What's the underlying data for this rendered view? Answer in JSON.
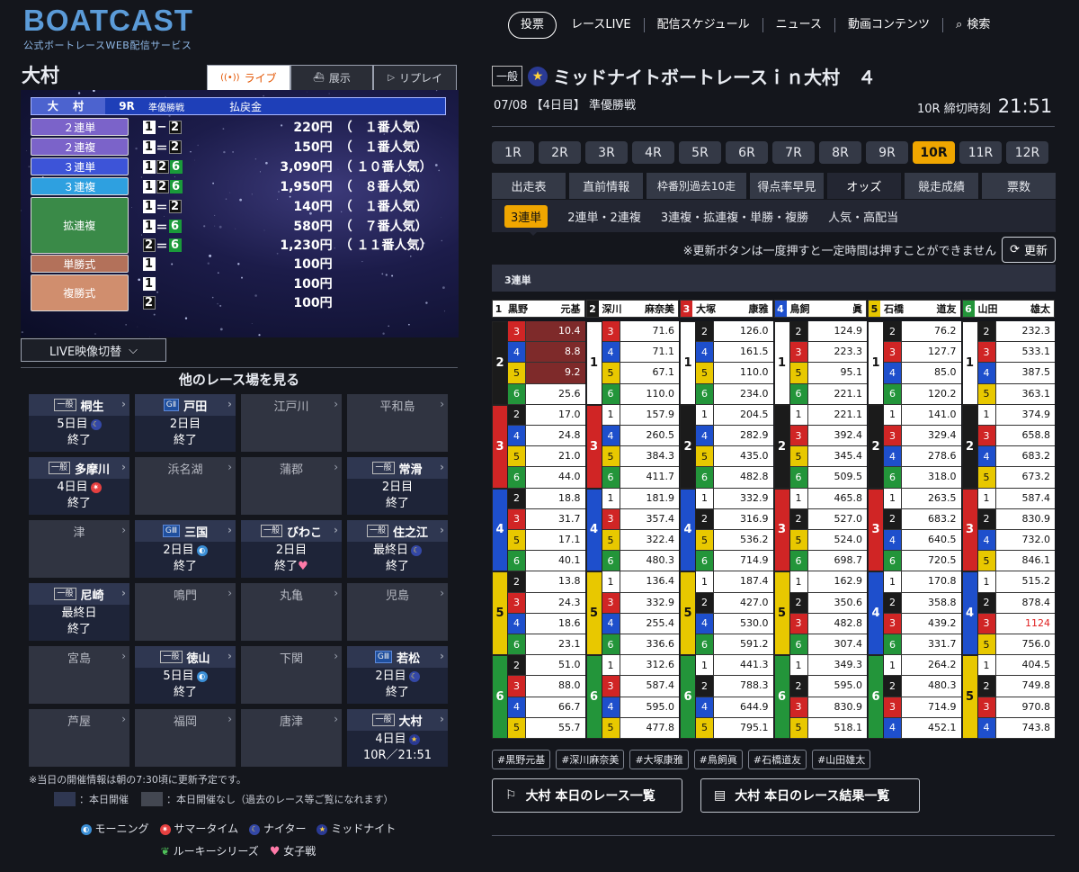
{
  "header": {
    "logo": "BOATCAST",
    "logo_sub": "公式ボートレースWEB配信サービス",
    "nav": [
      "投票",
      "レースLIVE",
      "配信スケジュール",
      "ニュース",
      "動画コンテンツ",
      "検索"
    ]
  },
  "left": {
    "venue": "大村",
    "tabs": [
      "ライブ",
      "展示",
      "リプレイ"
    ],
    "payout": {
      "venue": "大 村",
      "race": "9R",
      "race_name": "準優勝戦",
      "col": "払戻金",
      "rows": [
        {
          "label": "２連単",
          "nums": [
            "1",
            "2"
          ],
          "sep": "−",
          "amount": "220円",
          "pop": "（　１番人気）",
          "color": "#7b63c9"
        },
        {
          "label": "２連複",
          "nums": [
            "1",
            "2"
          ],
          "sep": "＝",
          "amount": "150円",
          "pop": "（　１番人気）",
          "color": "#7b63c9"
        },
        {
          "label": "３連単",
          "nums": [
            "1",
            "2",
            "6"
          ],
          "sep": "",
          "amount": "3,090円",
          "pop": "（ １０番人気）",
          "color": "#3d54d8"
        },
        {
          "label": "３連複",
          "nums": [
            "1",
            "2",
            "6"
          ],
          "sep": "",
          "amount": "1,950円",
          "pop": "（　８番人気）",
          "color": "#2ea0e0"
        },
        {
          "label": "拡連複",
          "nums": [
            "1",
            "2"
          ],
          "sep": "＝",
          "amount": "140円",
          "pop": "（　１番人気）",
          "color": "#3a8a48"
        },
        {
          "label": "",
          "nums": [
            "1",
            "6"
          ],
          "sep": "＝",
          "amount": "580円",
          "pop": "（　７番人気）",
          "color": ""
        },
        {
          "label": "",
          "nums": [
            "2",
            "6"
          ],
          "sep": "＝",
          "amount": "1,230円",
          "pop": "（ １１番人気）",
          "color": ""
        },
        {
          "label": "単勝式",
          "nums": [
            "1"
          ],
          "sep": "",
          "amount": "100円",
          "pop": "",
          "color": "#b3715a"
        },
        {
          "label": "複勝式",
          "nums": [
            "1"
          ],
          "sep": "",
          "amount": "100円",
          "pop": "",
          "color": "#d08e6e"
        },
        {
          "label": "",
          "nums": [
            "2"
          ],
          "sep": "",
          "amount": "100円",
          "pop": "",
          "color": ""
        }
      ]
    },
    "live_switch": "LIVE映像切替",
    "other_title": "他のレース場を見る",
    "venues": [
      {
        "name": "桐生",
        "grade": "一般",
        "day": "5日目",
        "icon": "moon",
        "status": "終了",
        "active": true
      },
      {
        "name": "戸田",
        "grade": "GⅡ",
        "day": "2日目",
        "icon": "",
        "status": "終了",
        "active": true
      },
      {
        "name": "江戸川",
        "grade": "",
        "day": "",
        "icon": "",
        "status": "",
        "active": false
      },
      {
        "name": "平和島",
        "grade": "",
        "day": "",
        "icon": "",
        "status": "",
        "active": false
      },
      {
        "name": "多摩川",
        "grade": "一般",
        "day": "4日目",
        "icon": "sum",
        "status": "終了",
        "active": true
      },
      {
        "name": "浜名湖",
        "grade": "",
        "day": "",
        "icon": "",
        "status": "",
        "active": false
      },
      {
        "name": "蒲郡",
        "grade": "",
        "day": "",
        "icon": "",
        "status": "",
        "active": false
      },
      {
        "name": "常滑",
        "grade": "一般",
        "day": "2日目",
        "icon": "",
        "status": "終了",
        "active": true
      },
      {
        "name": "津",
        "grade": "",
        "day": "",
        "icon": "",
        "status": "",
        "active": false
      },
      {
        "name": "三国",
        "grade": "GⅢ",
        "day": "2日目",
        "icon": "morn",
        "status": "終了",
        "active": true
      },
      {
        "name": "びわこ",
        "grade": "一般",
        "day": "2日目",
        "icon": "",
        "status": "終了",
        "heart": true,
        "active": true
      },
      {
        "name": "住之江",
        "grade": "一般",
        "day": "最終日",
        "icon": "moon",
        "status": "終了",
        "active": true
      },
      {
        "name": "尼崎",
        "grade": "一般",
        "day": "最終日",
        "icon": "",
        "status": "終了",
        "active": true
      },
      {
        "name": "鳴門",
        "grade": "",
        "day": "",
        "icon": "",
        "status": "",
        "active": false
      },
      {
        "name": "丸亀",
        "grade": "",
        "day": "",
        "icon": "",
        "status": "",
        "active": false
      },
      {
        "name": "児島",
        "grade": "",
        "day": "",
        "icon": "",
        "status": "",
        "active": false
      },
      {
        "name": "宮島",
        "grade": "",
        "day": "",
        "icon": "",
        "status": "",
        "active": false
      },
      {
        "name": "徳山",
        "grade": "一般",
        "day": "5日目",
        "icon": "morn",
        "status": "終了",
        "active": true
      },
      {
        "name": "下関",
        "grade": "",
        "day": "",
        "icon": "",
        "status": "",
        "active": false
      },
      {
        "name": "若松",
        "grade": "GⅢ",
        "day": "2日目",
        "icon": "moon",
        "status": "終了",
        "active": true
      },
      {
        "name": "芦屋",
        "grade": "",
        "day": "",
        "icon": "",
        "status": "",
        "active": false
      },
      {
        "name": "福岡",
        "grade": "",
        "day": "",
        "icon": "",
        "status": "",
        "active": false
      },
      {
        "name": "唐津",
        "grade": "",
        "day": "",
        "icon": "",
        "status": "",
        "active": false
      },
      {
        "name": "大村",
        "grade": "一般",
        "day": "4日目",
        "icon": "star",
        "status": "10R／21:51",
        "active": true
      }
    ],
    "note": "※当日の開催情報は朝の7:30頃に更新予定です。",
    "legend_active": "：本日開催",
    "legend_inactive": "：本日開催なし（過去のレース等ご覧になれます）",
    "legend_icons": [
      "モーニング",
      "サマータイム",
      "ナイター",
      "ミッドナイト",
      "ルーキーシリーズ",
      "女子戦"
    ]
  },
  "right": {
    "grade": "一般",
    "title": "ミッドナイトボートレースｉｎ大村　４",
    "subtitle": "07/08 【4日目】 準優勝戦",
    "deadline_label": "10R 締切時刻",
    "deadline_time": "21:51",
    "races": [
      "1R",
      "2R",
      "3R",
      "4R",
      "5R",
      "6R",
      "7R",
      "8R",
      "9R",
      "10R",
      "11R",
      "12R"
    ],
    "active_race": "10R",
    "tabs": [
      "出走表",
      "直前情報",
      "枠番別過去10走",
      "得点率早見",
      "オッズ",
      "競走成績",
      "票数"
    ],
    "active_tab": "オッズ",
    "odds_tabs": [
      "3連単",
      "2連単・2連複",
      "3連複・拡連複・単勝・複勝",
      "人気・高配当"
    ],
    "update_note": "※更新ボタンは一度押すと一定時間は押すことができません",
    "update_btn": "更新",
    "table_title": "3連単",
    "racers": [
      {
        "no": "1",
        "sei": "黒野",
        "mei": "元基"
      },
      {
        "no": "2",
        "sei": "深川",
        "mei": "麻奈美"
      },
      {
        "no": "3",
        "sei": "大塚",
        "mei": "康雅"
      },
      {
        "no": "4",
        "sei": "鳥飼",
        "mei": "眞"
      },
      {
        "no": "5",
        "sei": "石橋",
        "mei": "道友"
      },
      {
        "no": "6",
        "sei": "山田",
        "mei": "雄太"
      }
    ],
    "odds": [
      [
        [
          "2",
          [
            [
              "1",
              [
                [
                  "3",
                  "10.4"
                ],
                [
                  "4",
                  "8.8"
                ],
                [
                  "5",
                  "9.2"
                ],
                [
                  "6",
                  "25.6"
                ]
              ]
            ]
          ]
        ],
        [
          "3",
          [
            [
              "2",
              "17.0"
            ],
            [
              "4",
              "24.8"
            ],
            [
              "5",
              "21.0"
            ],
            [
              "6",
              "44.0"
            ]
          ]
        ],
        [
          "4",
          [
            [
              "2",
              "18.8"
            ],
            [
              "3",
              "31.7"
            ],
            [
              "5",
              "17.1"
            ],
            [
              "6",
              "40.1"
            ]
          ]
        ],
        [
          "5",
          [
            [
              "2",
              "13.8"
            ],
            [
              "3",
              "24.3"
            ],
            [
              "4",
              "18.6"
            ],
            [
              "6",
              "23.1"
            ]
          ]
        ],
        [
          "6",
          [
            [
              "2",
              "51.0"
            ],
            [
              "3",
              "88.0"
            ],
            [
              "4",
              "66.7"
            ],
            [
              "5",
              "55.7"
            ]
          ]
        ]
      ]
    ],
    "hashtags": [
      "#黒野元基",
      "#深川麻奈美",
      "#大塚康雅",
      "#鳥飼眞",
      "#石橋道友",
      "#山田雄太"
    ],
    "link1": "大村 本日のレース一覧",
    "link2": "大村 本日のレース結果一覧",
    "grid": {
      "second": [
        [
          "2",
          "3",
          "4",
          "5",
          "6"
        ],
        [
          "1",
          "3",
          "4",
          "5",
          "6"
        ],
        [
          "1",
          "2",
          "4",
          "5",
          "6"
        ],
        [
          "1",
          "2",
          "3",
          "5",
          "6"
        ],
        [
          "1",
          "2",
          "3",
          "4",
          "6"
        ],
        [
          "1",
          "2",
          "3",
          "4",
          "5"
        ]
      ],
      "thirds": [
        [
          [
            "3",
            "4",
            "5",
            "6"
          ],
          [
            "2",
            "4",
            "5",
            "6"
          ],
          [
            "2",
            "3",
            "5",
            "6"
          ],
          [
            "2",
            "3",
            "4",
            "6"
          ],
          [
            "2",
            "3",
            "4",
            "5"
          ]
        ],
        [
          [
            "3",
            "4",
            "5",
            "6"
          ],
          [
            "1",
            "4",
            "5",
            "6"
          ],
          [
            "1",
            "3",
            "5",
            "6"
          ],
          [
            "1",
            "3",
            "4",
            "6"
          ],
          [
            "1",
            "3",
            "4",
            "5"
          ]
        ],
        [
          [
            "2",
            "4",
            "5",
            "6"
          ],
          [
            "1",
            "4",
            "5",
            "6"
          ],
          [
            "1",
            "2",
            "5",
            "6"
          ],
          [
            "1",
            "2",
            "4",
            "6"
          ],
          [
            "1",
            "2",
            "4",
            "5"
          ]
        ],
        [
          [
            "2",
            "3",
            "5",
            "6"
          ],
          [
            "1",
            "3",
            "5",
            "6"
          ],
          [
            "1",
            "2",
            "5",
            "6"
          ],
          [
            "1",
            "2",
            "3",
            "6"
          ],
          [
            "1",
            "2",
            "3",
            "5"
          ]
        ],
        [
          [
            "2",
            "3",
            "4",
            "6"
          ],
          [
            "1",
            "3",
            "4",
            "6"
          ],
          [
            "1",
            "2",
            "4",
            "6"
          ],
          [
            "1",
            "2",
            "3",
            "6"
          ],
          [
            "1",
            "2",
            "3",
            "4"
          ]
        ],
        [
          [
            "2",
            "3",
            "4",
            "5"
          ],
          [
            "1",
            "3",
            "4",
            "5"
          ],
          [
            "1",
            "2",
            "4",
            "5"
          ],
          [
            "1",
            "2",
            "3",
            "5"
          ],
          [
            "1",
            "2",
            "3",
            "4"
          ]
        ]
      ],
      "values": [
        [
          [
            "10.4",
            "8.8",
            "9.2",
            "25.6"
          ],
          [
            "17.0",
            "24.8",
            "21.0",
            "44.0"
          ],
          [
            "18.8",
            "31.7",
            "17.1",
            "40.1"
          ],
          [
            "13.8",
            "24.3",
            "18.6",
            "23.1"
          ],
          [
            "51.0",
            "88.0",
            "66.7",
            "55.7"
          ]
        ],
        [
          [
            "71.6",
            "71.1",
            "67.1",
            "110.0"
          ],
          [
            "157.9",
            "260.5",
            "384.3",
            "411.7"
          ],
          [
            "181.9",
            "357.4",
            "322.4",
            "480.3"
          ],
          [
            "136.4",
            "332.9",
            "255.4",
            "336.6"
          ],
          [
            "312.6",
            "587.4",
            "595.0",
            "477.8"
          ]
        ],
        [
          [
            "126.0",
            "161.5",
            "110.0",
            "234.0"
          ],
          [
            "204.5",
            "282.9",
            "435.0",
            "482.8"
          ],
          [
            "332.9",
            "316.9",
            "536.2",
            "714.9"
          ],
          [
            "187.4",
            "427.0",
            "530.0",
            "591.2"
          ],
          [
            "441.3",
            "788.3",
            "644.9",
            "795.1"
          ]
        ],
        [
          [
            "124.9",
            "223.3",
            "95.1",
            "221.1"
          ],
          [
            "221.1",
            "392.4",
            "345.4",
            "509.5"
          ],
          [
            "465.8",
            "527.0",
            "524.0",
            "698.7"
          ],
          [
            "162.9",
            "350.6",
            "482.8",
            "307.4"
          ],
          [
            "349.3",
            "595.0",
            "830.9",
            "518.1"
          ]
        ],
        [
          [
            "76.2",
            "127.7",
            "85.0",
            "120.2"
          ],
          [
            "141.0",
            "329.4",
            "278.6",
            "318.0"
          ],
          [
            "263.5",
            "683.2",
            "640.5",
            "720.5"
          ],
          [
            "170.8",
            "358.8",
            "439.2",
            "331.7"
          ],
          [
            "264.2",
            "480.3",
            "714.9",
            "452.1"
          ]
        ],
        [
          [
            "232.3",
            "533.1",
            "387.5",
            "363.1"
          ],
          [
            "374.9",
            "658.8",
            "683.2",
            "673.2"
          ],
          [
            "587.4",
            "830.9",
            "732.0",
            "846.1"
          ],
          [
            "515.2",
            "878.4",
            "1124",
            "756.0"
          ],
          [
            "404.5",
            "749.8",
            "970.8",
            "743.8"
          ]
        ]
      ],
      "hot": [
        "10.4",
        "8.8",
        "9.2"
      ],
      "highlight": "1124"
    }
  },
  "colors": {
    "accent": "#f0a600",
    "live": "#e35400",
    "boat1": "#ffffff",
    "boat2": "#1b1b1b",
    "boat3": "#d02525",
    "boat4": "#1e4fcc",
    "boat5": "#e8c800",
    "boat6": "#23953a"
  }
}
